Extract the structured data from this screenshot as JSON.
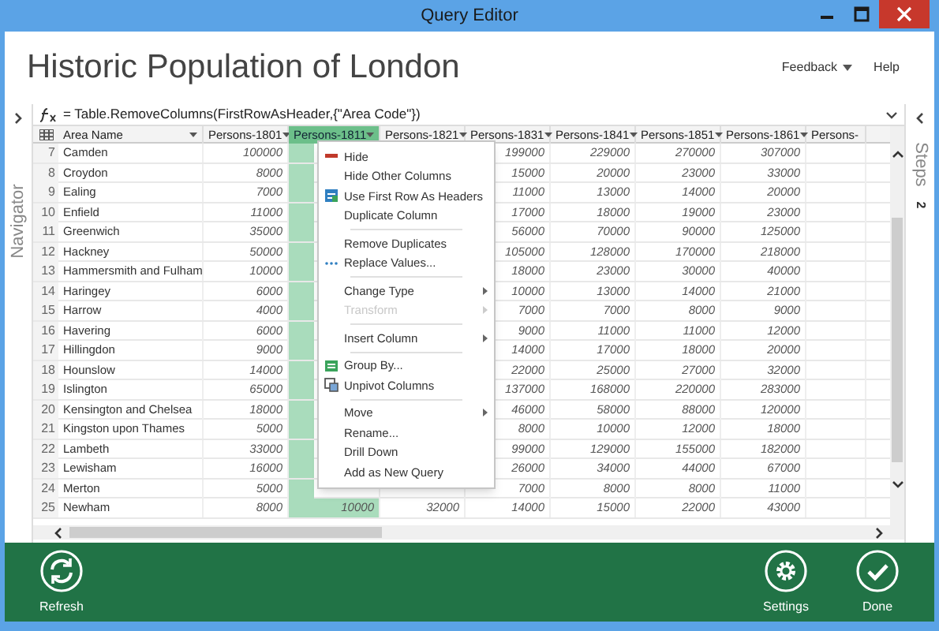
{
  "window": {
    "title": "Query Editor"
  },
  "page_title": "Historic Population of London",
  "header_links": [
    {
      "label": "Feedback",
      "has_menu": true
    },
    {
      "label": "Help",
      "has_menu": false
    }
  ],
  "navigator": {
    "label": "Navigator"
  },
  "steps": {
    "label": "Steps",
    "count": "2"
  },
  "formula": "= Table.RemoveColumns(FirstRowAsHeader,{\"Area Code\"})",
  "table": {
    "columns": [
      {
        "label": "Area Name",
        "selected": false
      },
      {
        "label": "Persons-1801",
        "selected": false
      },
      {
        "label": "Persons-1811",
        "selected": true
      },
      {
        "label": "Persons-1821",
        "selected": false
      },
      {
        "label": "Persons-1831",
        "selected": false
      },
      {
        "label": "Persons-1841",
        "selected": false
      },
      {
        "label": "Persons-1851",
        "selected": false
      },
      {
        "label": "Persons-1861",
        "selected": false
      },
      {
        "label": "Persons-",
        "selected": false
      }
    ],
    "rows": [
      {
        "num": "7",
        "cells": [
          "Camden",
          "100000",
          null,
          null,
          "199000",
          "229000",
          "270000",
          "307000",
          null
        ]
      },
      {
        "num": "8",
        "cells": [
          "Croydon",
          "8000",
          null,
          null,
          "15000",
          "20000",
          "23000",
          "33000",
          null
        ]
      },
      {
        "num": "9",
        "cells": [
          "Ealing",
          "7000",
          null,
          null,
          "11000",
          "13000",
          "14000",
          "20000",
          null
        ]
      },
      {
        "num": "10",
        "cells": [
          "Enfield",
          "11000",
          null,
          null,
          "17000",
          "18000",
          "19000",
          "23000",
          null
        ]
      },
      {
        "num": "11",
        "cells": [
          "Greenwich",
          "35000",
          null,
          null,
          "56000",
          "70000",
          "90000",
          "125000",
          null
        ]
      },
      {
        "num": "12",
        "cells": [
          "Hackney",
          "50000",
          null,
          null,
          "105000",
          "128000",
          "170000",
          "218000",
          null
        ]
      },
      {
        "num": "13",
        "cells": [
          "Hammersmith and Fulham",
          "10000",
          null,
          null,
          "18000",
          "23000",
          "30000",
          "40000",
          null
        ]
      },
      {
        "num": "14",
        "cells": [
          "Haringey",
          "6000",
          null,
          null,
          "10000",
          "13000",
          "14000",
          "21000",
          null
        ]
      },
      {
        "num": "15",
        "cells": [
          "Harrow",
          "4000",
          null,
          null,
          "7000",
          "7000",
          "8000",
          "9000",
          null
        ]
      },
      {
        "num": "16",
        "cells": [
          "Havering",
          "6000",
          null,
          null,
          "9000",
          "11000",
          "11000",
          "12000",
          null
        ]
      },
      {
        "num": "17",
        "cells": [
          "Hillingdon",
          "9000",
          null,
          null,
          "14000",
          "17000",
          "18000",
          "20000",
          null
        ]
      },
      {
        "num": "18",
        "cells": [
          "Hounslow",
          "14000",
          null,
          null,
          "22000",
          "25000",
          "27000",
          "32000",
          null
        ]
      },
      {
        "num": "19",
        "cells": [
          "Islington",
          "65000",
          null,
          null,
          "137000",
          "168000",
          "220000",
          "283000",
          null
        ]
      },
      {
        "num": "20",
        "cells": [
          "Kensington and Chelsea",
          "18000",
          null,
          null,
          "46000",
          "58000",
          "88000",
          "120000",
          null
        ]
      },
      {
        "num": "21",
        "cells": [
          "Kingston upon Thames",
          "5000",
          null,
          null,
          "8000",
          "10000",
          "12000",
          "18000",
          null
        ]
      },
      {
        "num": "22",
        "cells": [
          "Lambeth",
          "33000",
          null,
          null,
          "99000",
          "129000",
          "155000",
          "182000",
          null
        ]
      },
      {
        "num": "23",
        "cells": [
          "Lewisham",
          "16000",
          null,
          null,
          "26000",
          "34000",
          "44000",
          "67000",
          null
        ]
      },
      {
        "num": "24",
        "cells": [
          "Merton",
          "5000",
          null,
          null,
          "7000",
          "8000",
          "8000",
          "11000",
          null
        ]
      },
      {
        "num": "25",
        "cells": [
          "Newham",
          "8000",
          "10000",
          "32000",
          "14000",
          "15000",
          "22000",
          "43000",
          null
        ]
      }
    ]
  },
  "context_menu": [
    {
      "kind": "item",
      "label": "Hide",
      "submenu": false,
      "disabled": false
    },
    {
      "kind": "item",
      "label": "Hide Other Columns",
      "submenu": false,
      "disabled": false
    },
    {
      "kind": "item",
      "label": "Use First Row As Headers",
      "submenu": false,
      "disabled": false
    },
    {
      "kind": "item",
      "label": "Duplicate Column",
      "submenu": false,
      "disabled": false
    },
    {
      "kind": "divider"
    },
    {
      "kind": "item",
      "label": "Remove Duplicates",
      "submenu": false,
      "disabled": false
    },
    {
      "kind": "item",
      "label": "Replace Values...",
      "submenu": false,
      "disabled": false
    },
    {
      "kind": "divider"
    },
    {
      "kind": "item",
      "label": "Change Type",
      "submenu": true,
      "disabled": false
    },
    {
      "kind": "item",
      "label": "Transform",
      "submenu": true,
      "disabled": true
    },
    {
      "kind": "divider"
    },
    {
      "kind": "item",
      "label": "Insert Column",
      "submenu": true,
      "disabled": false
    },
    {
      "kind": "divider"
    },
    {
      "kind": "item",
      "label": "Group By...",
      "submenu": false,
      "disabled": false
    },
    {
      "kind": "item",
      "label": "Unpivot Columns",
      "submenu": false,
      "disabled": false
    },
    {
      "kind": "divider"
    },
    {
      "kind": "item",
      "label": "Move",
      "submenu": true,
      "disabled": false
    },
    {
      "kind": "item",
      "label": "Rename...",
      "submenu": false,
      "disabled": false
    },
    {
      "kind": "item",
      "label": "Drill Down",
      "submenu": false,
      "disabled": false
    },
    {
      "kind": "item",
      "label": "Add as New Query",
      "submenu": false,
      "disabled": false
    }
  ],
  "footer": [
    {
      "label": "Refresh"
    },
    {
      "label": "Settings"
    },
    {
      "label": "Done"
    }
  ]
}
